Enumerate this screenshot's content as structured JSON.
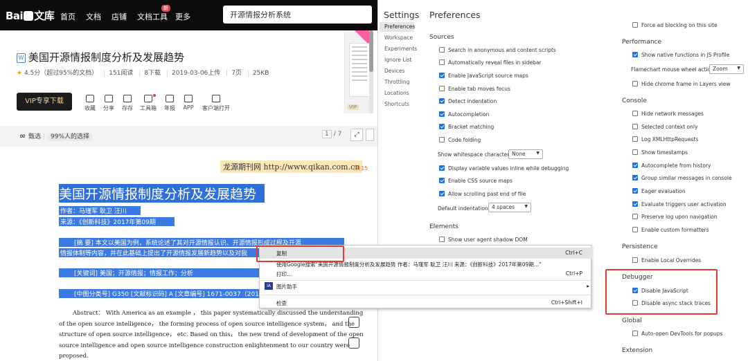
{
  "nav": {
    "logo_text": "Bai",
    "logo_suffix": "文库",
    "items": [
      "首页",
      "文档",
      "店铺",
      "文档工具",
      "更多"
    ],
    "badge": "新"
  },
  "search": {
    "value": "开源情报分析系统"
  },
  "doc": {
    "type_icon": "W",
    "title": "美国开源情报制度分析及发展趋势",
    "rating": "4.5分",
    "rating_note": "（超过95%的文档）",
    "reads": "151阅读",
    "downloads": "8下载",
    "date": "2019-03-06上传",
    "pages": "7页",
    "size": "25KB"
  },
  "toolbar": {
    "vip_download": "VIP专享下载",
    "tools": [
      "收藏",
      "分享",
      "存存",
      "工具箱",
      "年报",
      "APP",
      "客户端打开"
    ]
  },
  "thumb": {
    "vip": "VIP"
  },
  "featured": {
    "icon": "∞",
    "label": "甄选",
    "note": "99%人的选择"
  },
  "pager": {
    "current": "1",
    "total": "/ 7"
  },
  "paper": {
    "journal": "龙源期刊网 http://www.qikan.com.cn",
    "count_note": "(共15",
    "title": "美国开源情报制度分析及发展趋势",
    "author": "作者：马瑾军 耿卫 汪川",
    "source": "来源：《创新科技》2017年第09期",
    "abstract_cn_1": "[摘 要] 本文以美国为例，系统论述了其对开源情报认识、开源情报形成过程及开源",
    "abstract_cn_2": "情报体制等内容，并在此基础上提出了开源情报发展新趋势以及对我",
    "keywords": "[关键词] 美国；开源情报；情报工作；分析",
    "classification": "[中图分类号] G350 [文献标识码] A [文章编号] 1671-0037（201",
    "abstract_en": [
      "Abstract： With America as an example ， this paper systematically discussed the understanding",
      "of the open source intelligence， the forming process of open source intelligence system， and the",
      "structure of open source intelligence， etc. Based on this， the new trend of development of the open",
      "source intelligence and open source intelligence construction enlightenment to our country were",
      "proposed."
    ]
  },
  "context_menu": {
    "copy": "复制",
    "copy_shortcut": "Ctrl+C",
    "search": "使用Google搜索\"美国开源情报制度分析及发展趋势 作者：马瑾军 耿卫 汪川 来源：《创新科技》2017年第09期...\"",
    "print": "打印...",
    "print_shortcut": "Ctrl+P",
    "image_helper_icon": "IA",
    "image_helper": "图片助手",
    "inspect": "检查",
    "inspect_shortcut": "Ctrl+Shift+I"
  },
  "settings": {
    "title": "Settings",
    "page_title": "Preferences",
    "nav": [
      "Preferences",
      "Workspace",
      "Experiments",
      "Ignore List",
      "Devices",
      "Throttling",
      "Locations",
      "Shortcuts"
    ],
    "sources": {
      "header": "Sources",
      "items": [
        {
          "label": "Search in anonymous and content scripts",
          "checked": false
        },
        {
          "label": "Automatically reveal files in sidebar",
          "checked": false
        },
        {
          "label": "Enable JavaScript source maps",
          "checked": true
        },
        {
          "label": "Enable tab moves focus",
          "checked": false
        },
        {
          "label": "Detect indentation",
          "checked": true
        },
        {
          "label": "Autocompletion",
          "checked": true
        },
        {
          "label": "Bracket matching",
          "checked": true
        },
        {
          "label": "Code folding",
          "checked": false
        }
      ],
      "whitespace_label": "Show whitespace characters:",
      "whitespace_value": "None",
      "items2": [
        {
          "label": "Display variable values inline while debugging",
          "checked": true
        },
        {
          "label": "Enable CSS source maps",
          "checked": true
        },
        {
          "label": "Allow scrolling past end of file",
          "checked": true
        }
      ],
      "indent_label": "Default indentation:",
      "indent_value": "4 spaces"
    },
    "elements": {
      "header": "Elements",
      "items": [
        {
          "label": "Show user agent shadow DOM",
          "checked": false
        }
      ]
    },
    "top_item": {
      "label": "Force ad blocking on this site",
      "checked": false
    },
    "performance": {
      "header": "Performance",
      "items": [
        {
          "label": "Show native functions in JS Profile",
          "checked": true
        }
      ],
      "flamechart_label": "Flamechart mouse wheel action:",
      "flamechart_value": "Zoom",
      "items2": [
        {
          "label": "Hide chrome frame in Layers view",
          "checked": false
        }
      ]
    },
    "console": {
      "header": "Console",
      "items": [
        {
          "label": "Hide network messages",
          "checked": false
        },
        {
          "label": "Selected context only",
          "checked": false
        },
        {
          "label": "Log XMLHttpRequests",
          "checked": false
        },
        {
          "label": "Show timestamps",
          "checked": false
        },
        {
          "label": "Autocomplete from history",
          "checked": true
        },
        {
          "label": "Group similar messages in console",
          "checked": true
        },
        {
          "label": "Eager evaluation",
          "checked": true
        },
        {
          "label": "Evaluate triggers user activation",
          "checked": true
        },
        {
          "label": "Preserve log upon navigation",
          "checked": false
        },
        {
          "label": "Enable custom formatters",
          "checked": false
        }
      ]
    },
    "persistence": {
      "header": "Persistence",
      "items": [
        {
          "label": "Enable Local Overrides",
          "checked": false
        }
      ]
    },
    "debugger": {
      "header": "Debugger",
      "items": [
        {
          "label": "Disable JavaScript",
          "checked": true
        },
        {
          "label": "Disable async stack traces",
          "checked": false
        }
      ]
    },
    "global": {
      "header": "Global",
      "items": [
        {
          "label": "Auto-open DevTools for popups",
          "checked": false
        }
      ]
    },
    "extension": {
      "header": "Extension"
    }
  }
}
